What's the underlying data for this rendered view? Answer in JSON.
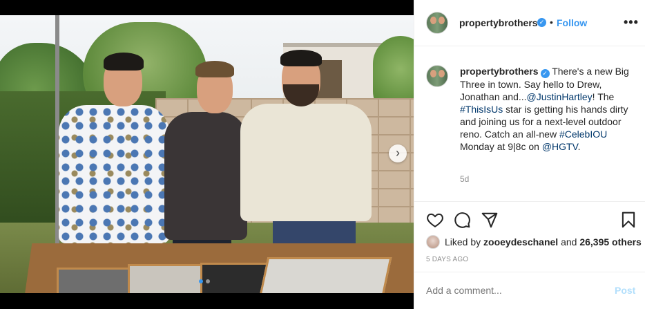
{
  "post": {
    "username": "propertybrothers",
    "verified_mark": "✓",
    "bullet": "•",
    "follow_label": "Follow",
    "more_label": "•••"
  },
  "caption": {
    "username": "propertybrothers",
    "text_1": " There's a new Big Three in town. Say hello to Drew, Jonathan and...",
    "mention_1": "@JustinHartley",
    "text_2": "! The ",
    "hashtag_1": "#ThisIsUs",
    "text_3": " star is getting his hands dirty and joining us for a next-level outdoor reno. Catch an all-new ",
    "hashtag_2": "#CelebIOU",
    "text_4": " Monday at 9|8c on ",
    "mention_2": "@HGTV",
    "text_5": ".",
    "age": "5d"
  },
  "likes": {
    "prefix": "Liked by ",
    "first_liker": "zooeydeschanel",
    "middle": " and ",
    "count": "26,395 others"
  },
  "timestamp": "5 DAYS AGO",
  "comment_box": {
    "placeholder": "Add a comment...",
    "post_label": "Post"
  },
  "carousel": {
    "next_glyph": "›",
    "slide_count": 2,
    "active_slide": 1
  },
  "icons": {
    "like": "heart-icon",
    "comment": "comment-bubble-icon",
    "share": "paper-plane-icon",
    "save": "bookmark-icon",
    "verified": "verified-badge-icon",
    "more": "more-options-icon",
    "next": "chevron-right-icon"
  },
  "colors": {
    "link_blue": "#3897f0",
    "tag_navy": "#00376b",
    "muted_gray": "#8e8e8e",
    "post_disabled": "#b2dffc"
  }
}
